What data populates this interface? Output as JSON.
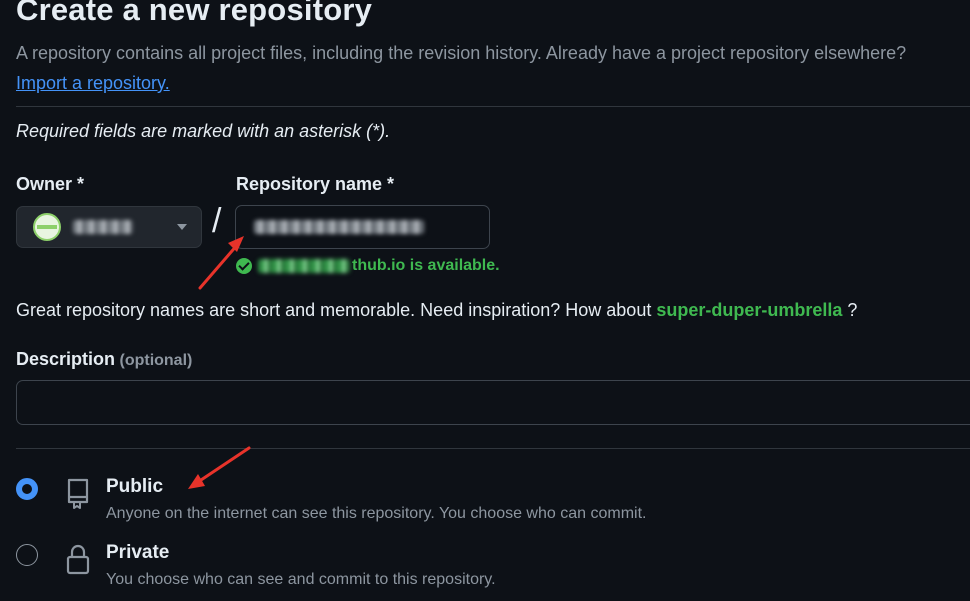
{
  "page": {
    "title": "Create a new repository",
    "intro_text": "A repository contains all project files, including the revision history. Already have a project repository elsewhere?",
    "import_link": "Import a repository.",
    "required_note": "Required fields are marked with an asterisk (*)."
  },
  "owner": {
    "label": "Owner *",
    "dropdown_icon": "chevron-down-icon"
  },
  "separator": "/",
  "repository": {
    "label": "Repository name *",
    "availability_suffix": "thub.io is available.",
    "availability_icon": "check-circle-icon"
  },
  "suggestion": {
    "text": "Great repository names are short and memorable. Need inspiration? How about",
    "name": "super-duper-umbrella",
    "suffix": "?"
  },
  "description": {
    "label": "Description",
    "optional": "(optional)",
    "value": ""
  },
  "visibility": {
    "options": [
      {
        "title": "Public",
        "subtitle": "Anyone on the internet can see this repository. You choose who can commit.",
        "icon": "repo-icon",
        "selected": true
      },
      {
        "title": "Private",
        "subtitle": "You choose who can see and commit to this repository.",
        "icon": "lock-icon",
        "selected": false
      }
    ]
  },
  "colors": {
    "background": "#0d1117",
    "link": "#4493f8",
    "success": "#3fb950",
    "annotation_arrow": "#e8332a"
  }
}
